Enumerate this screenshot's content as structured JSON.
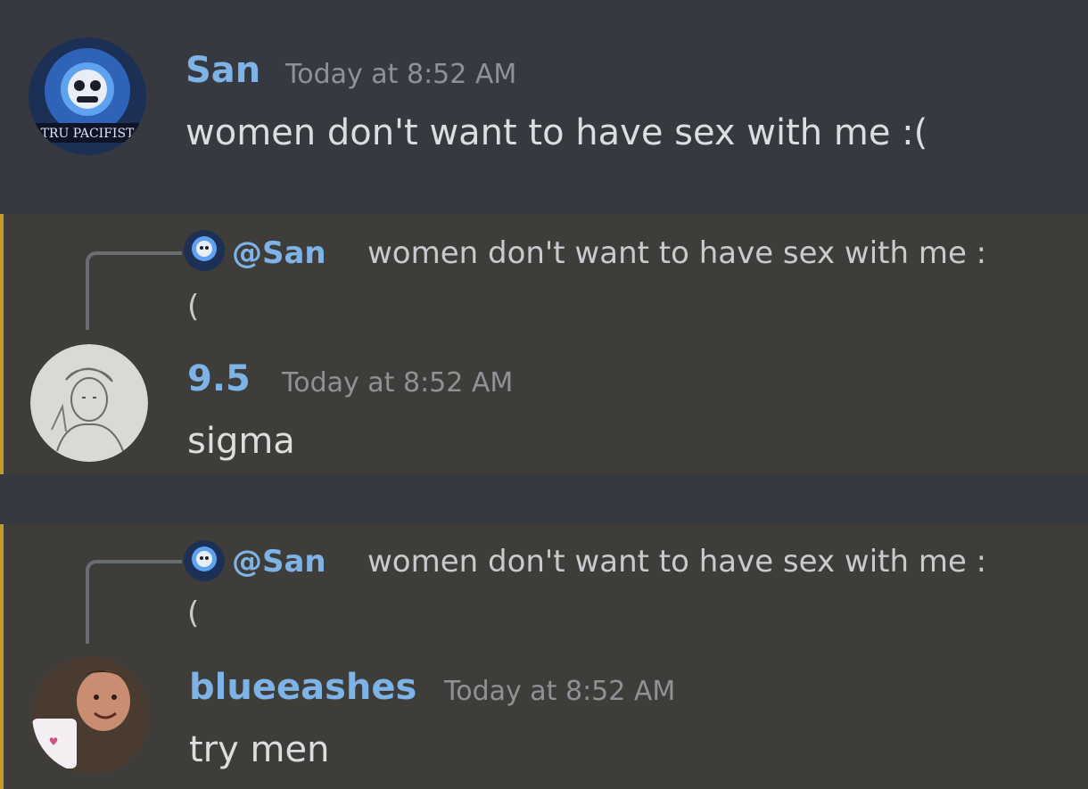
{
  "colors": {
    "background": "#36393f",
    "highlight_background": "#3f3d39",
    "mention_bar": "#c29d2d",
    "author_blue": "#7eb3e8",
    "timestamp": "#8e9196",
    "text": "#dcddde"
  },
  "messages": [
    {
      "author": "San",
      "timestamp": "Today at 8:52 AM",
      "content": "women don't want to have sex with me :(",
      "avatar_icon": "skeleton-avatar-icon",
      "avatar_caption": "TRU PACIFIST"
    },
    {
      "reply_to": {
        "mention": "@San",
        "text": "women don't want to have sex with me :",
        "text_wrap": "("
      },
      "author": "9.5",
      "timestamp": "Today at 8:52 AM",
      "content": "sigma",
      "avatar_icon": "sketch-avatar-icon"
    },
    {
      "reply_to": {
        "mention": "@San",
        "text": "women don't want to have sex with me :",
        "text_wrap": "("
      },
      "author": "blueeashes",
      "timestamp": "Today at 8:52 AM",
      "content": "try men",
      "avatar_icon": "person-mug-avatar-icon"
    }
  ]
}
